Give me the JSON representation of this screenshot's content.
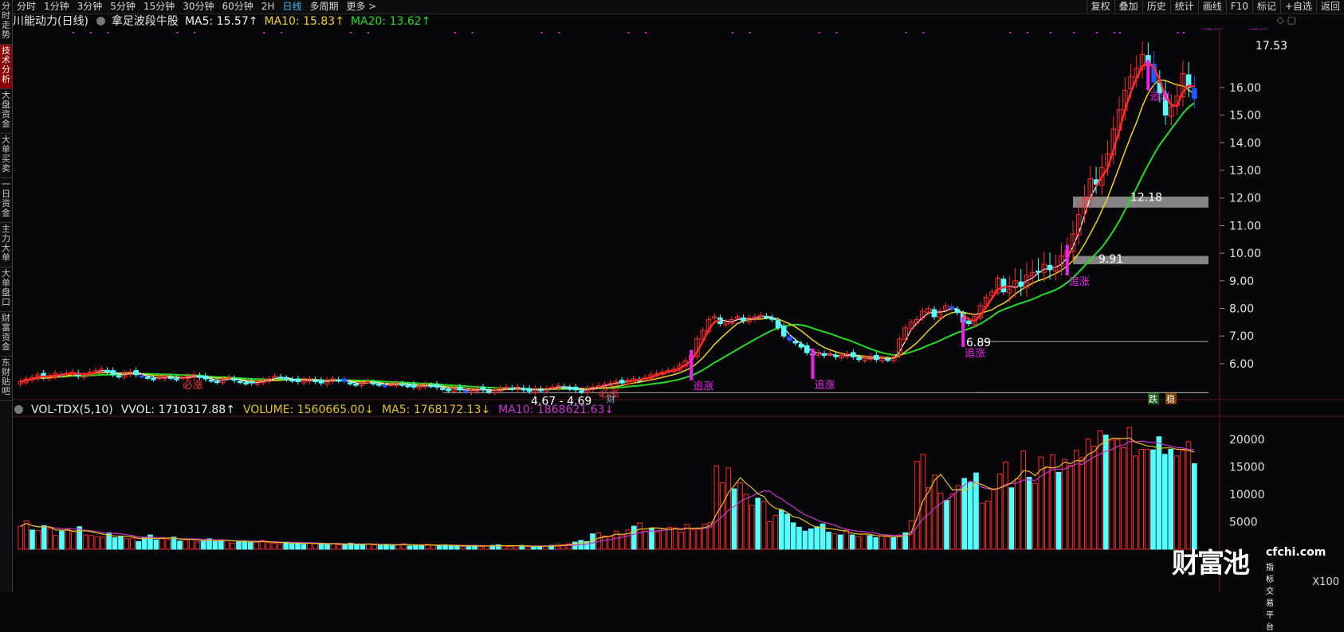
{
  "sidebar": {
    "tabs": [
      {
        "label": "分时走势",
        "active": false
      },
      {
        "label": "技术分析",
        "active": true
      },
      {
        "label": "大盘资金",
        "active": false
      },
      {
        "label": "大单买卖",
        "active": false
      },
      {
        "label": "一日资金",
        "active": false
      },
      {
        "label": "主力大单",
        "active": false
      },
      {
        "label": "大单盘口",
        "active": false
      },
      {
        "label": "财富资金",
        "active": false
      },
      {
        "label": "东财贴吧",
        "active": false
      }
    ]
  },
  "toolbar": {
    "timeframes": [
      "分时",
      "1分钟",
      "3分钟",
      "5分钟",
      "15分钟",
      "30分钟",
      "60分钟",
      "2H",
      "日线",
      "多周期",
      "更多 >"
    ],
    "active_timeframe": "日线",
    "tools": [
      "复权",
      "叠加",
      "历史",
      "统计",
      "画线",
      "F10",
      "标记",
      "+自选",
      "返回"
    ]
  },
  "header": {
    "title": "川能动力(日线)",
    "indicator": "拿足波段牛股",
    "ma5": "MA5: 15.57↑",
    "ma10": "MA10: 15.83↑",
    "ma20": "MA20: 13.62↑"
  },
  "volume_header": {
    "name": "VOL-TDX(5,10)",
    "vvol": "VVOL: 1710317.88↑",
    "volume": "VOLUME: 1560665.00↓",
    "ma5": "MA5: 1768172.13↓",
    "ma10": "MA10: 1868621.63↓"
  },
  "colors": {
    "up": "#ff2a2a",
    "down": "#54ffff",
    "ma5": "#ffffff",
    "ma10": "#f0d020",
    "ma20": "#22dd22",
    "signal": "#ee22ee",
    "vma10": "#cc33cc",
    "vma5": "#e8c020"
  },
  "misc": {
    "x100": "X100",
    "cai_marker": "财",
    "die_label": "跌",
    "wen_label": "稳"
  },
  "watermark": {
    "logo": "财富池",
    "site": "cfchi.com",
    "tagline": "指标交易平台"
  },
  "chart_data": [
    {
      "type": "candlestick",
      "title": "川能动力(日线)",
      "y_ticks": [
        6,
        7,
        8,
        9,
        10,
        11,
        12,
        13,
        14,
        15,
        16
      ],
      "y_tick_labels": [
        "6.00",
        "7.00",
        "8.00",
        "9.00",
        "10.00",
        "11.00",
        "12.00",
        "13.00",
        "14.00",
        "15.00",
        "16.00"
      ],
      "ylim": [
        4.7,
        17.9
      ],
      "closes": [
        5.35,
        5.45,
        5.5,
        5.6,
        5.5,
        5.55,
        5.65,
        5.6,
        5.65,
        5.7,
        5.55,
        5.6,
        5.7,
        5.75,
        5.8,
        5.7,
        5.6,
        5.55,
        5.65,
        5.7,
        5.6,
        5.55,
        5.5,
        5.45,
        5.5,
        5.55,
        5.5,
        5.45,
        5.5,
        5.55,
        5.6,
        5.5,
        5.45,
        5.4,
        5.35,
        5.45,
        5.5,
        5.4,
        5.35,
        5.3,
        5.3,
        5.35,
        5.4,
        5.45,
        5.55,
        5.5,
        5.45,
        5.4,
        5.35,
        5.4,
        5.45,
        5.35,
        5.3,
        5.4,
        5.45,
        5.4,
        5.35,
        5.3,
        5.25,
        5.3,
        5.35,
        5.3,
        5.25,
        5.2,
        5.25,
        5.3,
        5.25,
        5.2,
        5.15,
        5.2,
        5.25,
        5.2,
        5.15,
        5.1,
        5.05,
        5.1,
        5.05,
        5.0,
        5.05,
        5.1,
        5.05,
        5.0,
        5.05,
        5.1,
        5.15,
        5.1,
        5.15,
        5.05,
        5.0,
        5.1,
        5.05,
        5.1,
        5.15,
        5.2,
        5.15,
        5.1,
        5.05,
        5.0,
        5.1,
        5.15,
        5.2,
        5.25,
        5.3,
        5.35,
        5.3,
        5.4,
        5.45,
        5.4,
        5.5,
        5.6,
        5.65,
        5.7,
        5.75,
        5.8,
        5.95,
        6.1,
        6.3,
        6.9,
        7.2,
        7.6,
        7.7,
        7.45,
        7.5,
        7.6,
        7.7,
        7.55,
        7.65,
        7.7,
        7.75,
        7.7,
        7.6,
        7.3,
        7.0,
        6.85,
        6.75,
        6.6,
        6.4,
        6.35,
        6.4,
        6.3,
        6.35,
        6.25,
        6.3,
        6.35,
        6.25,
        6.15,
        6.2,
        6.25,
        6.15,
        6.2,
        6.15,
        6.25,
        6.9,
        7.3,
        7.5,
        7.6,
        7.9,
        8.0,
        7.7,
        7.9,
        8.1,
        8.0,
        7.85,
        7.5,
        7.45,
        7.7,
        8.1,
        8.4,
        8.6,
        9.1,
        8.6,
        8.7,
        9.0,
        8.8,
        9.2,
        9.3,
        9.35,
        9.6,
        9.4,
        9.5,
        9.9,
        10.1,
        10.7,
        11.4,
        12.0,
        12.7,
        12.5,
        13.1,
        13.6,
        14.5,
        15.2,
        15.9,
        16.4,
        16.7,
        17.2,
        16.8,
        16.2,
        15.8,
        15.0,
        15.3,
        15.7,
        16.5,
        16.0,
        15.6
      ],
      "highs_annotated": {
        "max": 17.53,
        "levels": [
          12.18,
          9.91,
          6.89,
          4.69
        ]
      },
      "annotations": [
        "17.53",
        "12.18",
        "9.91",
        "6.89",
        "4.67 - 4.69",
        "必涨",
        "追涨"
      ],
      "ma_lines": [
        "MA5",
        "MA10",
        "MA20"
      ],
      "zones": [
        {
          "low": 11.65,
          "high": 12.05
        },
        {
          "low": 9.6,
          "high": 9.9
        }
      ],
      "h_lines": [
        6.8,
        4.95
      ]
    },
    {
      "type": "bar",
      "title": "VOL-TDX(5,10)",
      "y_ticks": [
        5000,
        10000,
        15000,
        20000
      ],
      "y_tick_labels": [
        "5000",
        "10000",
        "15000",
        "20000"
      ],
      "ylim": [
        0,
        23500
      ],
      "unit_multiplier": "X100",
      "values": [
        4200,
        5200,
        3500,
        3400,
        4300,
        3800,
        2500,
        3300,
        3600,
        3200,
        4100,
        2600,
        2500,
        2300,
        2200,
        3000,
        2100,
        2400,
        1900,
        2000,
        1400,
        2100,
        2600,
        1700,
        2000,
        1800,
        2200,
        1500,
        1700,
        1800,
        1300,
        1500,
        1900,
        1400,
        1700,
        1600,
        1100,
        1400,
        1500,
        1200,
        1300,
        1600,
        1200,
        1100,
        1000,
        1300,
        1000,
        1200,
        900,
        1100,
        1000,
        1100,
        900,
        1000,
        800,
        900,
        1100,
        800,
        900,
        1000,
        800,
        700,
        900,
        700,
        800,
        1000,
        600,
        800,
        700,
        900,
        700,
        600,
        800,
        600,
        700,
        500,
        600,
        700,
        500,
        600,
        700,
        800,
        600,
        500,
        600,
        700,
        500,
        400,
        500,
        600,
        700,
        900,
        800,
        1000,
        1300,
        1600,
        1400,
        2800,
        3000,
        2400,
        2300,
        3300,
        2600,
        3500,
        4200,
        4800,
        3300,
        3800,
        3200,
        3700,
        4000,
        3900,
        3100,
        4500,
        3600,
        3900,
        4600,
        4900,
        15200,
        12100,
        14800,
        11000,
        12100,
        10000,
        8000,
        9300,
        8700,
        5000,
        6200,
        7100,
        6400,
        4800,
        4000,
        3300,
        3700,
        4100,
        4600,
        3100,
        2800,
        2600,
        3500,
        2600,
        2300,
        2800,
        2500,
        2100,
        2400,
        2300,
        2100,
        2600,
        3000,
        5200,
        16000,
        17300,
        11200,
        13500,
        10200,
        8900,
        10100,
        11600,
        12900,
        12200,
        13900,
        8400,
        8800,
        11000,
        13700,
        15900,
        11200,
        12800,
        17900,
        13100,
        12000,
        16800,
        15000,
        17200,
        14000,
        16400,
        15300,
        18000,
        16700,
        20100,
        18800,
        21600,
        20800,
        19900,
        20000,
        18500,
        22200,
        17000,
        18200,
        18200,
        18100,
        20500,
        17300,
        18200,
        17000,
        18000,
        19600,
        15600
      ],
      "up_flags": [
        1,
        1,
        0,
        1,
        0,
        1,
        1,
        0,
        1,
        1,
        0,
        1,
        1,
        1,
        1,
        0,
        0,
        0,
        1,
        1,
        0,
        0,
        0,
        0,
        1,
        1,
        0,
        0,
        1,
        1,
        1,
        0,
        0,
        0,
        0,
        1,
        1,
        0,
        0,
        0,
        1,
        1,
        1,
        1,
        1,
        0,
        0,
        0,
        0,
        1,
        1,
        0,
        0,
        1,
        1,
        0,
        0,
        0,
        0,
        1,
        1,
        0,
        0,
        0,
        1,
        1,
        0,
        0,
        0,
        1,
        1,
        0,
        0,
        0,
        0,
        1,
        0,
        0,
        1,
        1,
        0,
        0,
        1,
        1,
        1,
        0,
        1,
        0,
        0,
        1,
        0,
        1,
        1,
        1,
        0,
        0,
        0,
        0,
        1,
        1,
        1,
        1,
        1,
        1,
        0,
        1,
        1,
        0,
        1,
        1,
        1,
        1,
        1,
        1,
        1,
        1,
        1,
        1,
        1,
        1,
        1,
        0,
        1,
        1,
        1,
        0,
        1,
        1,
        1,
        0,
        0,
        0,
        0,
        0,
        0,
        0,
        0,
        0,
        1,
        0,
        1,
        0,
        1,
        1,
        0,
        0,
        1,
        1,
        0,
        1,
        0,
        1,
        1,
        1,
        1,
        1,
        1,
        0,
        1,
        1,
        0,
        0,
        0,
        1,
        1,
        1,
        1,
        1,
        0,
        1,
        1,
        0,
        1,
        1,
        1,
        1,
        0,
        1,
        1,
        1,
        1,
        1,
        1,
        1,
        0,
        1,
        1,
        1,
        1,
        1,
        1,
        1,
        0,
        0,
        0,
        0,
        1,
        1,
        1,
        0,
        0
      ]
    }
  ]
}
